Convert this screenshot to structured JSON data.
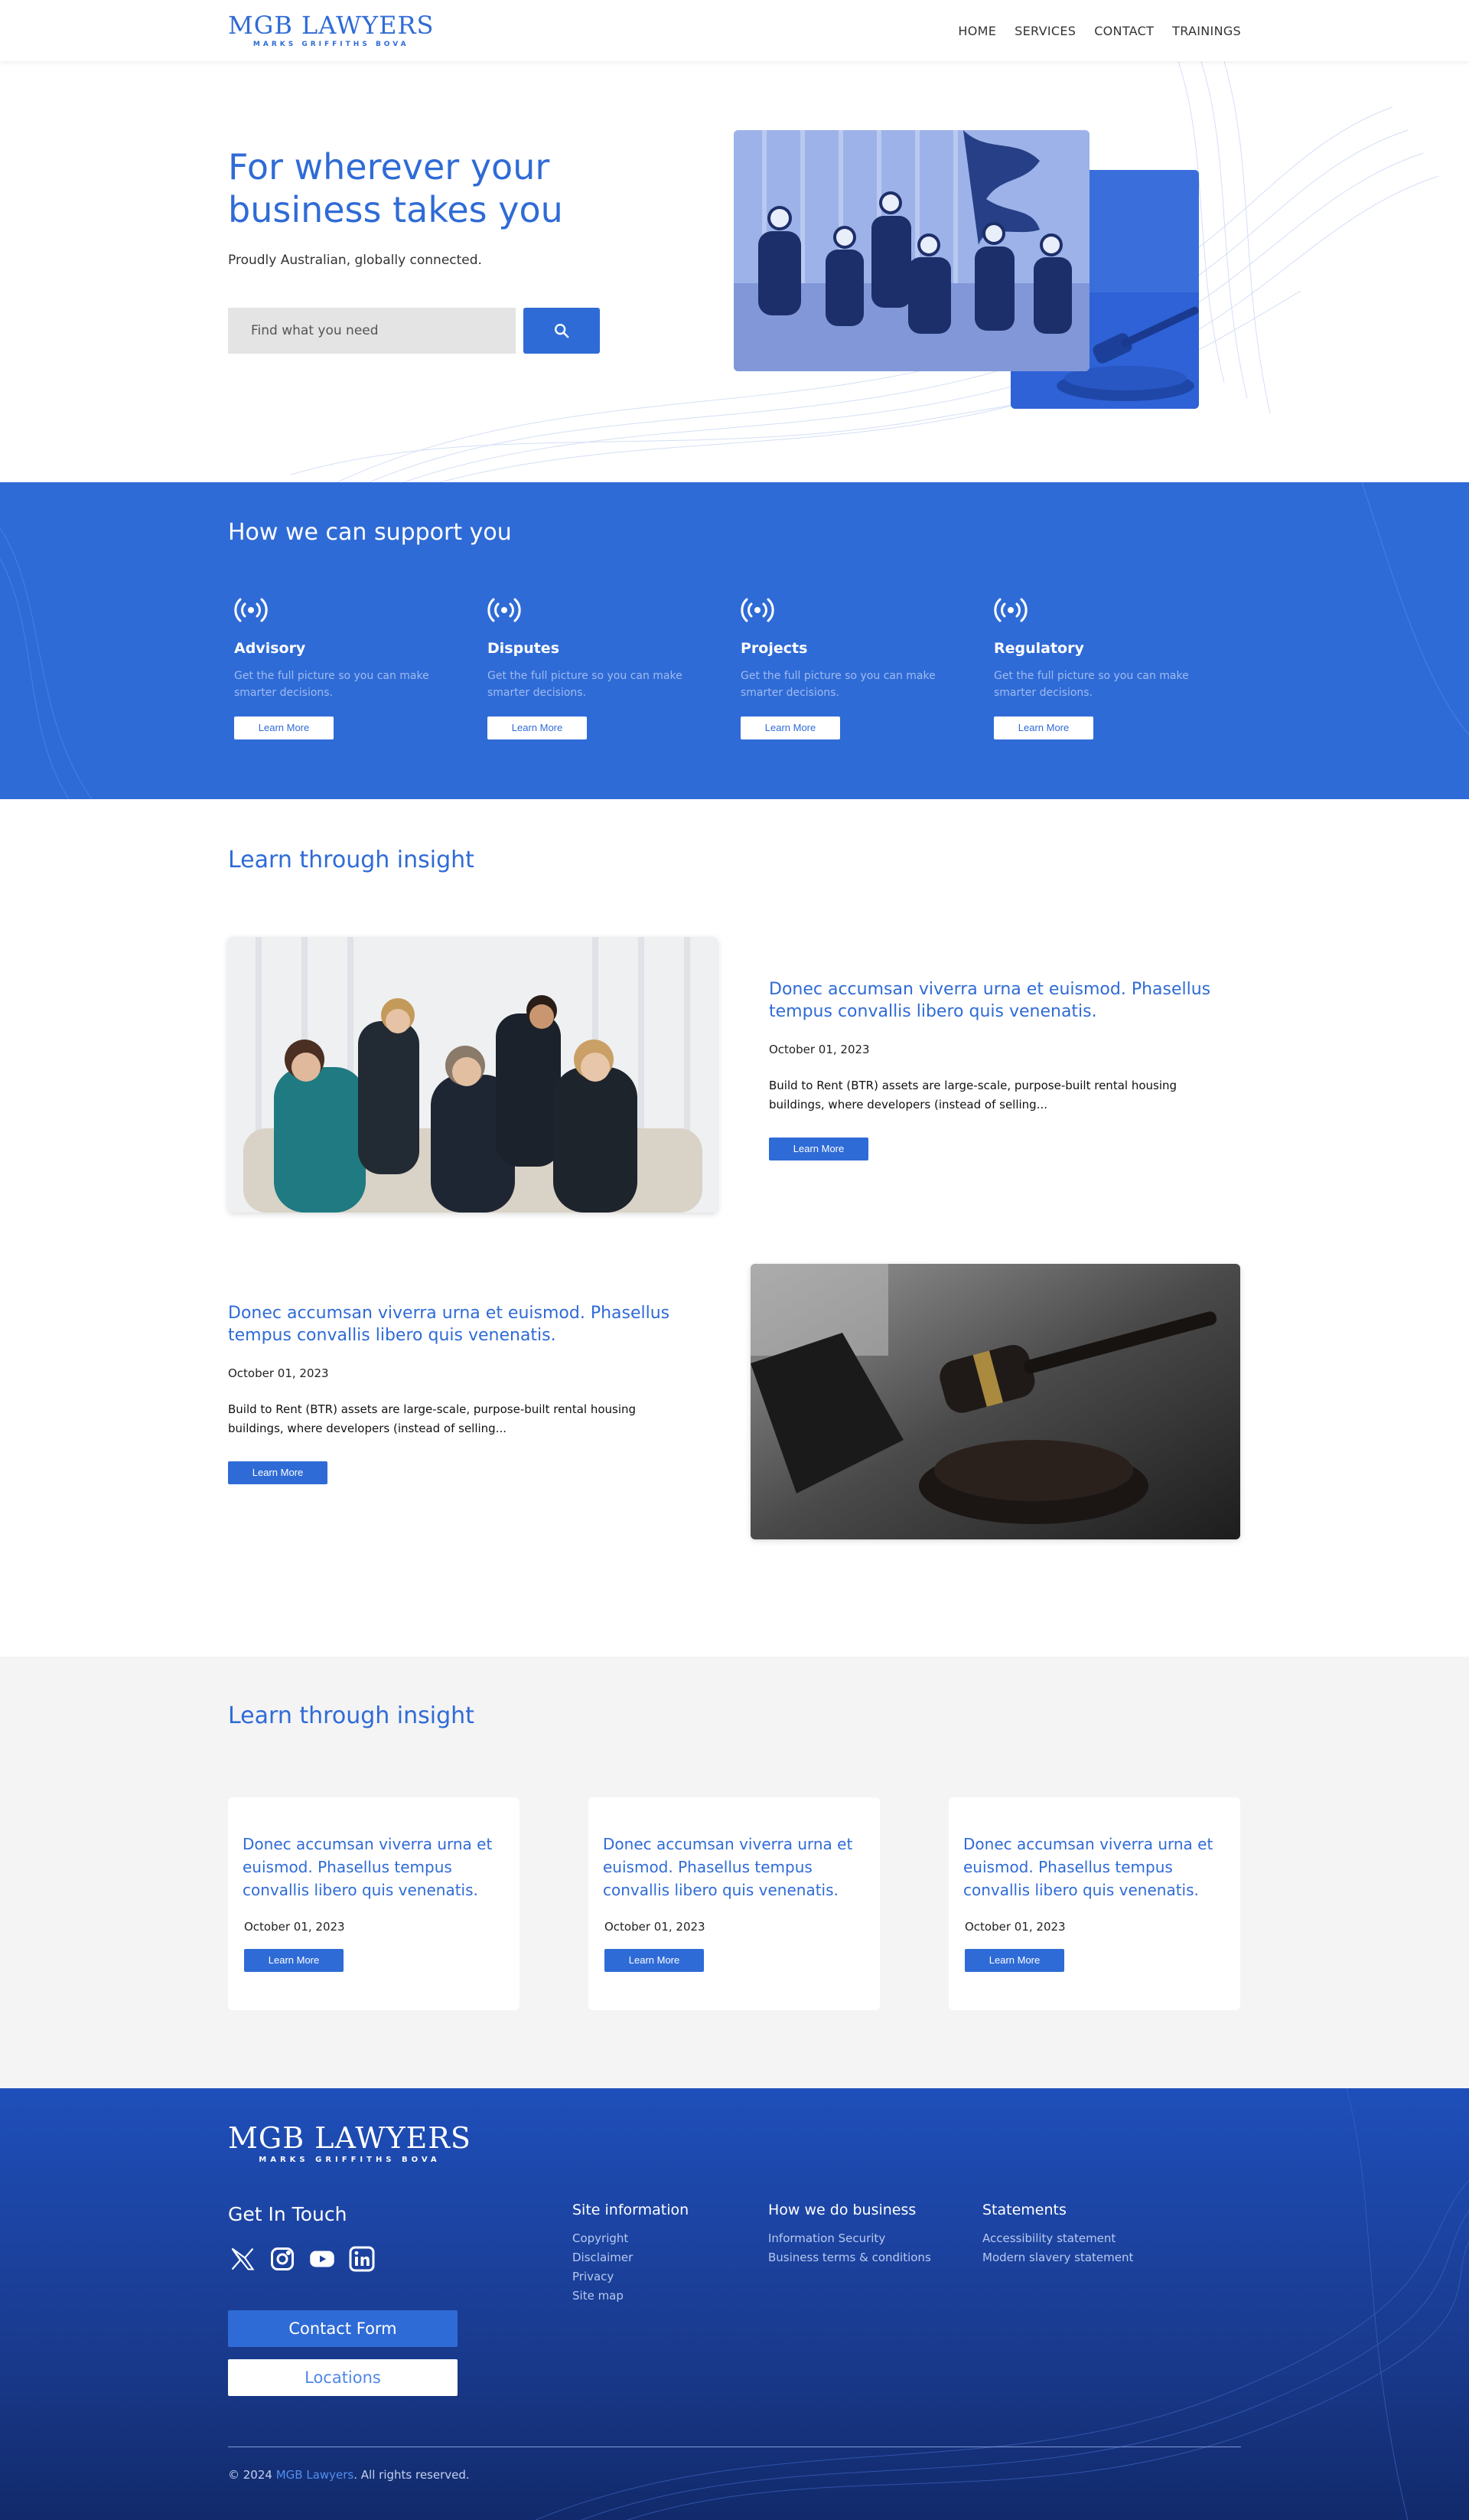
{
  "brand": {
    "name": "MGB LAWYERS",
    "tagline": "MARKS GRIFFITHS BOVA"
  },
  "nav": {
    "items": [
      "HOME",
      "SERVICES",
      "CONTACT",
      "TRAININGS"
    ]
  },
  "hero": {
    "title_line1": "For wherever your",
    "title_line2": "business takes you",
    "subtitle": "Proudly Australian, globally connected.",
    "search_placeholder": "Find what you need",
    "search_icon": "magnifier-icon"
  },
  "services": {
    "title": "How we can support you",
    "items": [
      {
        "name": "Advisory",
        "desc": "Get the full picture so you can make smarter decisions.",
        "button": "Learn More",
        "icon": "broadcast-icon"
      },
      {
        "name": "Disputes",
        "desc": "Get the full picture so you can make smarter decisions.",
        "button": "Learn More",
        "icon": "broadcast-icon"
      },
      {
        "name": "Projects",
        "desc": "Get the full picture so you can make smarter decisions.",
        "button": "Learn More",
        "icon": "broadcast-icon"
      },
      {
        "name": "Regulatory",
        "desc": "Get the full picture so you can make smarter decisions.",
        "button": "Learn More",
        "icon": "broadcast-icon"
      }
    ]
  },
  "insights": {
    "title": "Learn through insight",
    "articles": [
      {
        "title": "Donec accumsan viverra urna et euismod. Phasellus tempus convallis  libero quis venenatis.",
        "date": "October 01, 2023",
        "excerpt": "Build to Rent (BTR) assets are large-scale, purpose-built rental housing buildings, where developers (instead of selling...",
        "button": "Learn More"
      },
      {
        "title": "Donec accumsan viverra urna et euismod. Phasellus tempus convallis  libero quis venenatis.",
        "date": "October 01, 2023",
        "excerpt": "Build to Rent (BTR) assets are large-scale, purpose-built rental housing buildings, where developers (instead of selling...",
        "button": "Learn More"
      }
    ]
  },
  "insights2": {
    "title": "Learn through insight",
    "cards": [
      {
        "title": "Donec accumsan viverra urna et euismod. Phasellus tempus convallis  libero quis venenatis.",
        "date": "October 01, 2023",
        "button": "Learn More"
      },
      {
        "title": "Donec accumsan viverra urna et euismod. Phasellus tempus convallis  libero quis venenatis.",
        "date": "October 01, 2023",
        "button": "Learn More"
      },
      {
        "title": "Donec accumsan viverra urna et euismod. Phasellus tempus convallis  libero quis venenatis.",
        "date": "October 01, 2023",
        "button": "Learn More"
      }
    ]
  },
  "footer": {
    "touch_title": "Get In Touch",
    "socials": [
      "x-icon",
      "instagram-icon",
      "youtube-icon",
      "linkedin-icon"
    ],
    "contact_button": "Contact Form",
    "locations_button": "Locations",
    "columns": [
      {
        "heading": "Site information",
        "links": [
          "Copyright",
          "Disclaimer",
          "Privacy",
          "Site map"
        ]
      },
      {
        "heading": "How we do business",
        "links": [
          "Information Security",
          "Business terms & conditions"
        ]
      },
      {
        "heading": "Statements",
        "links": [
          "Accessibility statement",
          "Modern slavery statement"
        ]
      }
    ],
    "copyright_prefix": "© 2024 ",
    "copyright_brand": "MGB Lawyers",
    "copyright_suffix": ". All rights reserved."
  },
  "colors": {
    "primary": "#2f6bd6",
    "footer_dark": "#122a6b",
    "light_bg": "#f4f4f4"
  }
}
